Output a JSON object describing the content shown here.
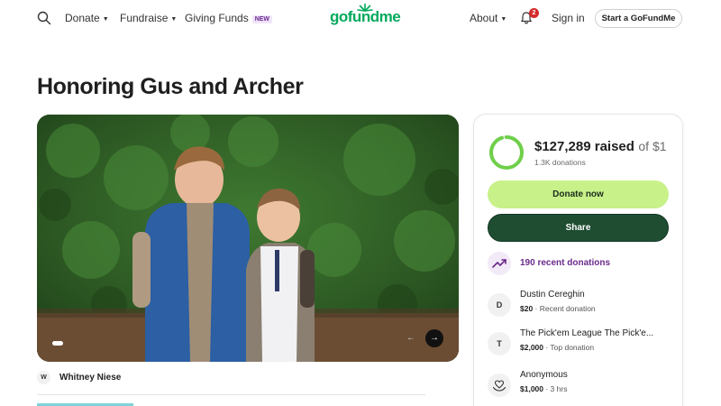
{
  "header": {
    "nav": [
      {
        "label": "Donate"
      },
      {
        "label": "Fundraise"
      },
      {
        "label": "Giving Funds",
        "badge": "NEW"
      }
    ],
    "logo": "gofundme",
    "about": "About",
    "notification_count": "2",
    "sign_in": "Sign in",
    "cta": "Start a GoFundMe"
  },
  "campaign": {
    "title": "Honoring Gus and Archer",
    "organizer_initial": "W",
    "organizer_name": "Whitney Niese"
  },
  "stats": {
    "raised": "$127,289 raised",
    "of_goal": "of $1",
    "donations": "1.3K donations",
    "progress_fraction": 0.95,
    "donate_label": "Donate now",
    "share_label": "Share",
    "recent_label": "190 recent donations"
  },
  "donors": [
    {
      "initial": "D",
      "name": "Dustin Cereghin",
      "amount": "$20",
      "note": " · Recent donation"
    },
    {
      "initial": "T",
      "name": "The Pick'em League The Pick'e...",
      "amount": "$2,000",
      "note": " · Top donation"
    },
    {
      "initial": "",
      "name": "Anonymous",
      "amount": "$1,000",
      "note": " · 3 hrs"
    }
  ],
  "colors": {
    "brand": "#02a95c",
    "donate_button": "#c8f18a",
    "share_button": "#1e4d32",
    "accent_purple": "#6b2a8c"
  }
}
